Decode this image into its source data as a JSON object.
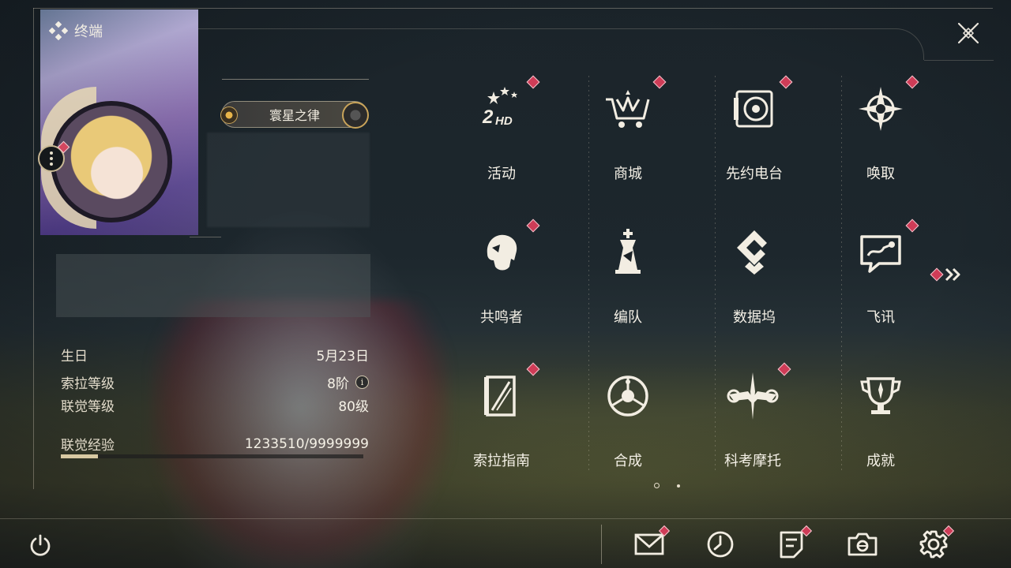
{
  "header": {
    "title": "终端"
  },
  "profile": {
    "title_badge": "寰星之律",
    "stats": [
      {
        "key": "生日",
        "value": "5月23日"
      },
      {
        "key": "索拉等级",
        "value": "8阶"
      },
      {
        "key": "联觉等级",
        "value": "80级"
      },
      {
        "key": "联觉经验",
        "value": "1233510/9999999"
      }
    ],
    "exp_progress": 0.123
  },
  "menu": [
    {
      "label": "活动",
      "icon": "activity-2hd-icon",
      "badge": true
    },
    {
      "label": "商城",
      "icon": "shop-cart-icon",
      "badge": true
    },
    {
      "label": "先约电台",
      "icon": "radio-icon",
      "badge": true
    },
    {
      "label": "唤取",
      "icon": "convene-compass-icon",
      "badge": true
    },
    {
      "label": "共鸣者",
      "icon": "resonator-head-icon",
      "badge": true
    },
    {
      "label": "编队",
      "icon": "team-chess-icon",
      "badge": false
    },
    {
      "label": "数据坞",
      "icon": "data-dock-icon",
      "badge": false
    },
    {
      "label": "飞讯",
      "icon": "message-chat-icon",
      "badge": true
    },
    {
      "label": "索拉指南",
      "icon": "guide-book-icon",
      "badge": true
    },
    {
      "label": "合成",
      "icon": "synthesis-icon",
      "badge": false
    },
    {
      "label": "科考摩托",
      "icon": "motorcycle-icon",
      "badge": true
    },
    {
      "label": "成就",
      "icon": "trophy-icon",
      "badge": false
    }
  ],
  "pagination": {
    "current": 1,
    "total": 2
  },
  "bottom_bar": [
    {
      "name": "mail",
      "icon": "mail-icon",
      "badge": true
    },
    {
      "name": "clock",
      "icon": "clock-icon",
      "badge": false
    },
    {
      "name": "notice",
      "icon": "notice-icon",
      "badge": true
    },
    {
      "name": "camera",
      "icon": "camera-icon",
      "badge": false
    },
    {
      "name": "settings",
      "icon": "gear-icon",
      "badge": true
    }
  ],
  "colors": {
    "accent_badge": "#cf3c57",
    "text": "#f4f0e6",
    "gold": "#d8c9a3"
  }
}
